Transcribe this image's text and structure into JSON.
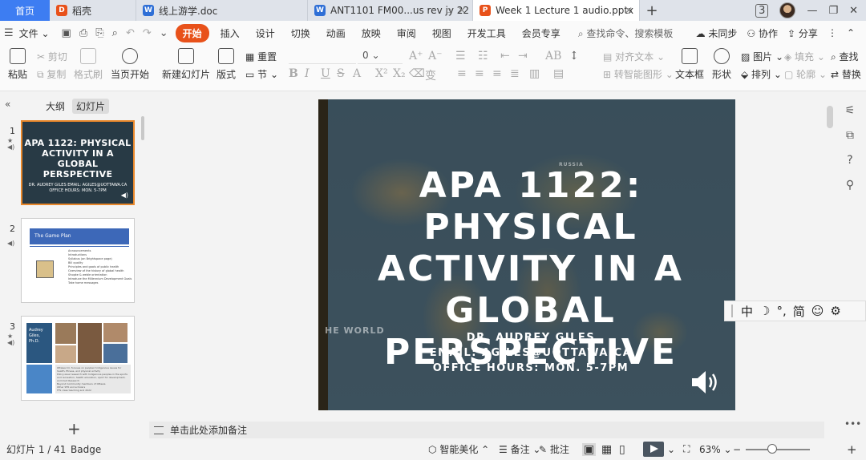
{
  "tabs": {
    "home": "首页",
    "t1": "稻壳",
    "t2": "线上游学.doc",
    "t3": "ANT1101 FM00...us rev jy 22",
    "t4": "Week 1 Lecture 1 audio.pptx",
    "count_badge": "3"
  },
  "menu": {
    "file": "文件",
    "start": "开始",
    "insert": "插入",
    "design": "设计",
    "transition": "切换",
    "animation": "动画",
    "slideshow": "放映",
    "review": "审阅",
    "view": "视图",
    "devtools": "开发工具",
    "member": "会员专享",
    "search": "查找命令、搜索模板",
    "sync": "未同步",
    "collab": "协作",
    "share": "分享"
  },
  "ribbon": {
    "cut": "剪切",
    "paste": "粘贴",
    "copy": "复制",
    "format_painter": "格式刷",
    "play_from_current": "当页开始",
    "new_slide": "新建幻灯片",
    "layout": "版式",
    "reset": "重置",
    "section": "节",
    "font_size": "0",
    "align_text": "对齐文本",
    "to_smartart": "转智能图形",
    "textbox": "文本框",
    "shape": "形状",
    "picture": "图片",
    "fill": "填充",
    "arrange": "排列",
    "outline": "轮廓",
    "find": "查找",
    "replace": "替换"
  },
  "leftpane": {
    "outline_tab": "大纲",
    "slides_tab": "幻灯片",
    "thumb1": {
      "number": "1",
      "title": "APA 1122: PHYSICAL ACTIVITY IN A GLOBAL PERSPECTIVE",
      "sub": "DR. AUDREY GILES EMAIL: AGILES@UOTTAWA.CA OFFICE HOURS: MON. 5-7PM"
    },
    "thumb2": {
      "number": "2",
      "header": "The Game Plan",
      "bullets": [
        "Announcements",
        "Introductions",
        "Syllabus (on Brightspace page)",
        "Bill quality",
        "Principles and goals of public health",
        "Overview of the history of global health",
        "Shopke & weble orientation",
        "Introduce the Millennium Development Goals",
        "Take home messages"
      ]
    },
    "thumb3": {
      "number": "3",
      "name": "Audrey Giles, Ph.D.",
      "bullets": [
        "Ottawa Cri, focuses on peoples' Indigenous issues for health, fitness, and physical activity",
        "Policy-level research with Indigenous peoples in the sports and recreation, health education, sport for development, and Inuit Research",
        "Beyond Community members of Ottawa",
        "Other SFR and scholars",
        "FFS class teaching and 2022"
      ]
    }
  },
  "slide": {
    "title": "APA 1122: PHYSICAL ACTIVITY IN A GLOBAL PERSPECTIVE",
    "line1": "DR. AUDREY GILES",
    "line2": "EMAIL: AGILES@UOTTAWA.CA",
    "line3": "OFFICE HOURS: MON. 5-7PM",
    "map_word": "HE WORLD",
    "map_small1": "RUSSIA"
  },
  "ime": {
    "zh": "中",
    "moon": "☽",
    "punct": "°,",
    "simp": "简",
    "emoji": "☺",
    "gear": "⚙"
  },
  "notes": {
    "placeholder": "单击此处添加备注"
  },
  "status": {
    "slide_count": "幻灯片 1 / 41",
    "theme": "Badge",
    "beautify": "智能美化",
    "notes": "备注",
    "comment": "批注",
    "zoom": "63%"
  }
}
